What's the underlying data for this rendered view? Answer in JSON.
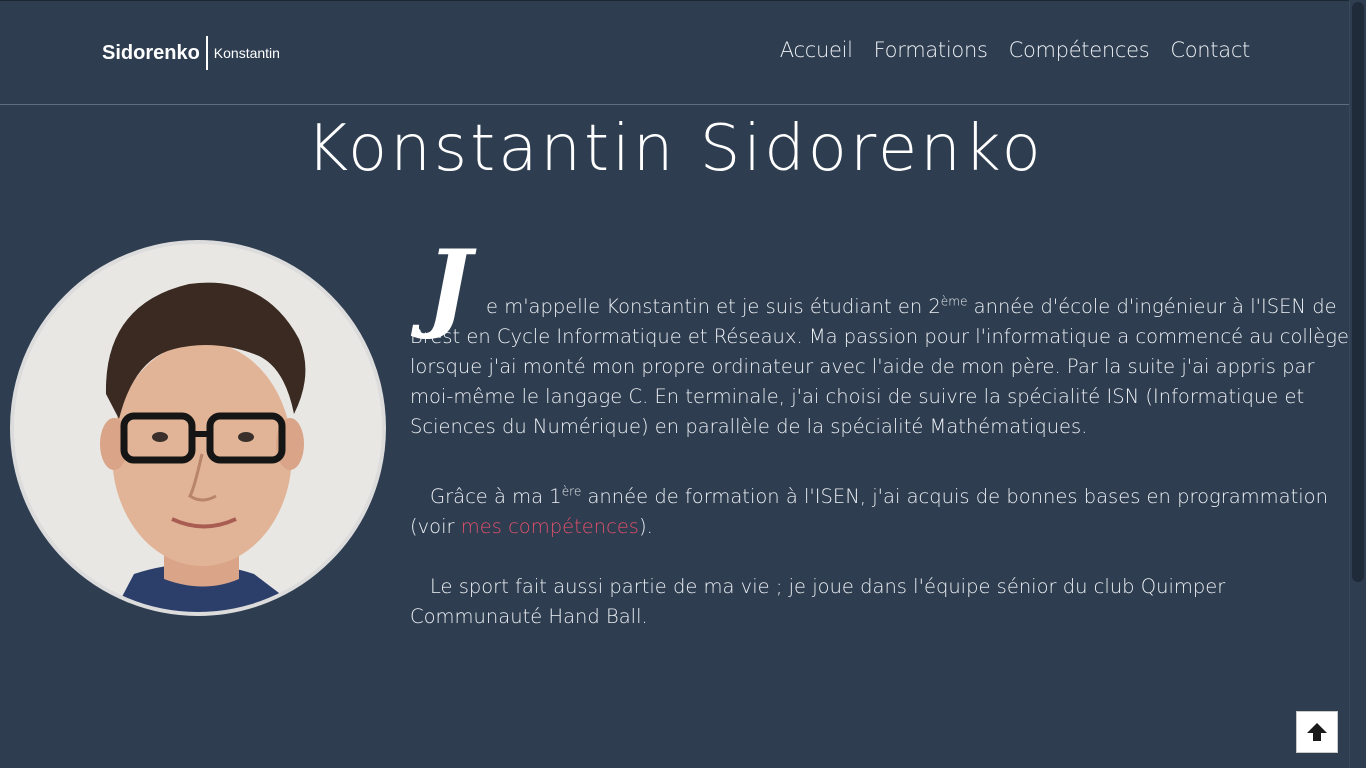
{
  "header": {
    "brand_first": "Sidorenko",
    "brand_second": "Konstantin",
    "nav": [
      "Accueil",
      "Formations",
      "Compétences",
      "Contact"
    ]
  },
  "title": "Konstantin Sidorenko",
  "bio": {
    "dropcap": "J",
    "p1_a": "e m'appelle Konstantin et je suis étudiant en 2",
    "p1_sup": "ème",
    "p1_b": " année d'école d'ingénieur à l'ISEN",
    "p1_rest": "de Brest en Cycle Informatique et Réseaux. Ma passion pour l'informatique a commencé au collège lorsque j'ai monté mon propre ordinateur avec l'aide de mon père. Par la suite j'ai appris par moi-même le langage C. En terminale, j'ai choisi de suivre la spécialité ISN (Informatique et Sciences du Numérique) en parallèle de la spécialité Mathématiques.",
    "p2_a": "Grâce à ma 1",
    "p2_sup": "ère",
    "p2_b": " année de formation à l'ISEN, j'ai acquis de bonnes bases en programmation (voir ",
    "p2_link": "mes compétences",
    "p2_c": ").",
    "p3": "Le sport fait aussi partie de ma vie ; je joue dans l'équipe sénior du club Quimper Communauté Hand Ball."
  },
  "icons": {
    "back_to_top": "arrow-up-icon",
    "photo": "profile-photo"
  },
  "colors": {
    "background": "#2e3d50",
    "link": "#e0506b",
    "text": "#eef1f5"
  }
}
